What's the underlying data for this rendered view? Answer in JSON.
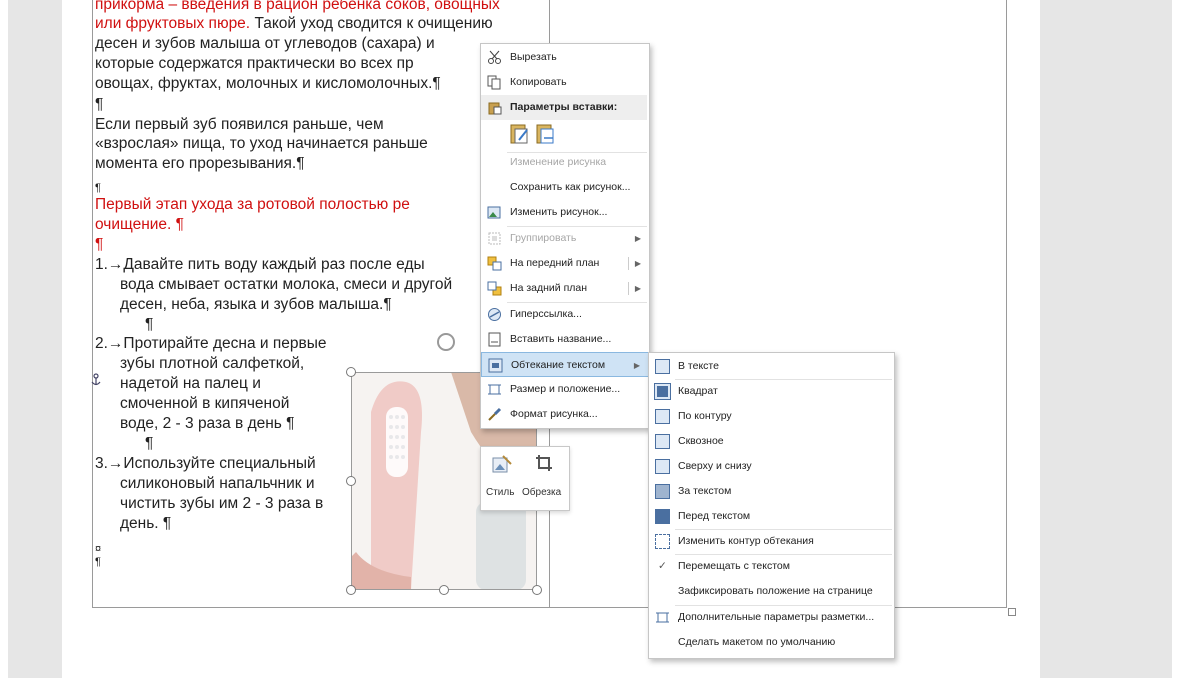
{
  "document": {
    "lines": [
      "прикорма – введения в рацион ребенка соков, овощных",
      "или фруктовых пюре. Такой уход сводится к очищению",
      "десен и зубов малыша от углеводов (сахара) и",
      "которые содержатся практически во всех пр",
      "овощах, фруктах, молочных и кисломолочных.¶",
      "¶",
      "Если первый зуб появился раньше, чем",
      "«взрослая» пища, то уход начинается раньше",
      "момента его прорезывания.¶",
      "¶",
      "Первый этап ухода за ротовой полостью ре",
      "очищение. ¶",
      "¶",
      "1.→Давайте пить воду каждый раз после еды",
      "вода смывает остатки молока, смеси и другой",
      "десен, неба, языка и зубов малыша.¶",
      "¶",
      "2.→Протирайте десна и первые",
      "зубы плотной салфеткой,",
      "надетой на палец и",
      "смоченной в кипяченой",
      "воде, 2 - 3 раза в день ¶",
      "¶",
      "3.→Используйте специальный",
      "силиконовый напальчник и",
      "чистить зубы им 2 - 3 раза в",
      "день. ¶",
      "¤",
      "¶"
    ]
  },
  "mini_toolbar": {
    "style_label": "Стиль",
    "crop_label": "Обрезка"
  },
  "context_menu": {
    "cut": "Вырезать",
    "copy": "Копировать",
    "paste_options": "Параметры вставки:",
    "change_picture_header": "Изменение рисунка",
    "save_as_picture": "Сохранить как рисунок...",
    "change_picture": "Изменить рисунок...",
    "group": "Группировать",
    "bring_forward": "На передний план",
    "send_backward": "На задний план",
    "hyperlink": "Гиперссылка...",
    "insert_caption": "Вставить название...",
    "wrap_text": "Обтекание текстом",
    "size_position": "Размер и положение...",
    "format_picture": "Формат рисунка..."
  },
  "submenu": {
    "in_line": "В тексте",
    "square": "Квадрат",
    "tight": "По контуру",
    "through": "Сквозное",
    "top_bottom": "Сверху и снизу",
    "behind": "За текстом",
    "in_front": "Перед текстом",
    "edit_wrap_points": "Изменить контур обтекания",
    "move_with_text": "Перемещать с текстом",
    "fix_position": "Зафиксировать положение на странице",
    "more_layout": "Дополнительные параметры разметки...",
    "set_default": "Сделать макетом по умолчанию",
    "check_mark": "✓"
  },
  "colors": {
    "red_text": "#d01010",
    "highlight": "#cfe3f5"
  }
}
